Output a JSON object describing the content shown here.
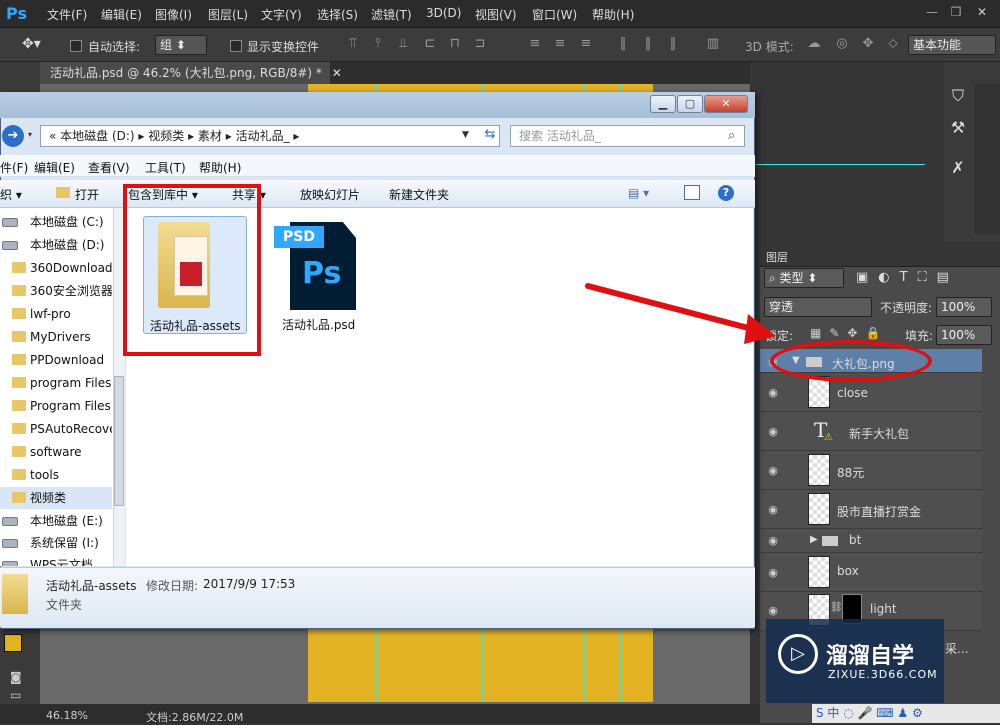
{
  "ps": {
    "logo": "Ps",
    "menu": [
      "文件(F)",
      "编辑(E)",
      "图像(I)",
      "图层(L)",
      "文字(Y)",
      "选择(S)",
      "滤镜(T)",
      "3D(D)",
      "视图(V)",
      "窗口(W)",
      "帮助(H)"
    ],
    "options": {
      "auto_select_label": "自动选择:",
      "auto_select_value": "组",
      "show_transform_label": "显示变换控件",
      "mode_3d_label": "3D 模式:",
      "workspace": "基本功能"
    },
    "doc_tab": "活动礼品.psd @ 46.2% (大礼包.png, RGB/8#) *",
    "status": {
      "zoom": "46.18%",
      "doc": "文档:2.86M/22.0M"
    }
  },
  "layers": {
    "title": "图层",
    "filter_type": "类型",
    "blend_mode": "穿透",
    "opacity_label": "不透明度:",
    "opacity": "100%",
    "lock_label": "锁定:",
    "fill_label": "填充:",
    "fill": "100%",
    "rows": [
      {
        "name": "大礼包.png",
        "kind": "group-open"
      },
      {
        "name": "close",
        "kind": "image"
      },
      {
        "name": "新手大礼包",
        "kind": "text"
      },
      {
        "name": "88元",
        "kind": "image"
      },
      {
        "name": "股市直播打赏金",
        "kind": "image"
      },
      {
        "name": "bt",
        "kind": "group"
      },
      {
        "name": "box",
        "kind": "image"
      },
      {
        "name": "light",
        "kind": "masked"
      }
    ]
  },
  "explorer": {
    "breadcrumb": "«  本地磁盘 (D:)  ▸  视频类  ▸  素材  ▸  活动礼品_  ▸",
    "search_placeholder": "搜索 活动礼品_",
    "menu": [
      "件(F)",
      "编辑(E)",
      "查看(V)",
      "工具(T)",
      "帮助(H)"
    ],
    "toolbar": [
      "织 ▾",
      "打开",
      "包含到库中 ▾",
      "共享 ▾",
      "放映幻灯片",
      "新建文件夹"
    ],
    "nav": [
      {
        "label": "本地磁盘 (C:)",
        "kind": "drive"
      },
      {
        "label": "本地磁盘 (D:)",
        "kind": "drive"
      },
      {
        "label": "360Download",
        "kind": "folder"
      },
      {
        "label": "360安全浏览器",
        "kind": "folder"
      },
      {
        "label": "lwf-pro",
        "kind": "folder"
      },
      {
        "label": "MyDrivers",
        "kind": "folder"
      },
      {
        "label": "PPDownload",
        "kind": "folder"
      },
      {
        "label": "program Files",
        "kind": "folder"
      },
      {
        "label": "Program Files",
        "kind": "folder"
      },
      {
        "label": "PSAutoRecove",
        "kind": "folder"
      },
      {
        "label": "software",
        "kind": "folder"
      },
      {
        "label": "tools",
        "kind": "folder"
      },
      {
        "label": "视频类",
        "kind": "folder",
        "selected": true
      },
      {
        "label": "本地磁盘 (E:)",
        "kind": "drive"
      },
      {
        "label": "系统保留 (I:)",
        "kind": "drive"
      },
      {
        "label": "WPS云文档",
        "kind": "drive"
      }
    ],
    "files": [
      {
        "name": "活动礼品-assets",
        "kind": "folder"
      },
      {
        "name": "活动礼品.psd",
        "kind": "psd",
        "icon_tag": "PSD",
        "icon_logo": "Ps"
      }
    ],
    "details": {
      "name": "活动礼品-assets",
      "modified_label": "修改日期:",
      "modified": "2017/9/9 17:53",
      "type": "文件夹"
    }
  },
  "watermark": {
    "name": "溜溜自学",
    "url": "ZIXUE.3D66.COM",
    "side_text": "采..."
  },
  "colors": {
    "ps_bg": "#353535",
    "canvas": "#e3b323",
    "guide": "#37e6e6",
    "annotation": "#e01010",
    "ps_blue": "#31a8ff"
  }
}
